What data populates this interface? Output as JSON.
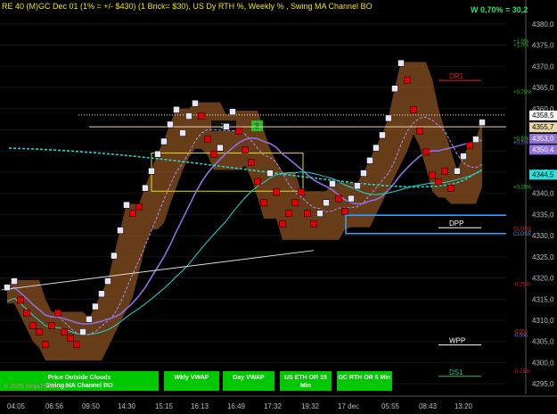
{
  "chart_title": "RE 40 (M)GC Dec 01  (1% = +/- $430) (1 Brick= $30), US Dy RTH %, Weekly % , Swing MA Channel BO",
  "weekly_stat": "W 0,70% = 30,2",
  "copyright": "© 2025 NinjaTrader, LLC",
  "colors": {
    "background": "#000000",
    "up_brick": "#e6e6f5",
    "down_brick": "#e00000",
    "band": "#8a5020",
    "ema_cyan": "#20d8d0",
    "ema_purple": "#9070e0",
    "buttons": "#00c800",
    "channel": "#e0e000"
  },
  "price_axis": {
    "ticks": [
      "4380,0",
      "4375,0",
      "4370,0",
      "4365,0",
      "4360,0",
      "4355,0",
      "4350,0",
      "4345,0",
      "4340,0",
      "4335,0",
      "4330,0",
      "4325,0",
      "4320,0",
      "4315,0",
      "4310,0",
      "4305,0",
      "4300,0",
      "4295,0"
    ],
    "ymin": 4292.5,
    "ymax": 4382.5
  },
  "price_badges": [
    {
      "value": "4358,5",
      "color": "#ffffff",
      "text_color": "#000000",
      "price": 4358.5
    },
    {
      "value": "4355,7",
      "color": "#e8d8a8",
      "text_color": "#000000",
      "price": 4355.7
    },
    {
      "value": "4353,0",
      "color": "#9070e0",
      "text_color": "#ffffff",
      "price": 4353.0
    },
    {
      "value": "4350,4",
      "color": "#9070e0",
      "text_color": "#ffffff",
      "price": 4350.4
    },
    {
      "value": "4344,5",
      "color": "#20e8e0",
      "text_color": "#000000",
      "price": 4344.5
    }
  ],
  "pct_labels": [
    {
      "text": "+1,0%",
      "color": "#20c020",
      "price": 4376.0
    },
    {
      "text": "+1,0%",
      "color": "#20c020",
      "price": 4375.0
    },
    {
      "text": "+0,75%",
      "color": "#20c020",
      "price": 4364.0
    },
    {
      "text": "+0,5%",
      "color": "#20c020",
      "price": 4353.0
    },
    {
      "text": "+0,5%",
      "color": "#9070e0",
      "price": 4352.0
    },
    {
      "text": "+0,25%",
      "color": "#20c020",
      "price": 4341.5
    },
    {
      "text": "CLOSE",
      "color": "#e02020",
      "price": 4331.6
    },
    {
      "text": "CLOSE",
      "color": "#5088e0",
      "price": 4330.4
    },
    {
      "text": "-0,25%",
      "color": "#e02020",
      "price": 4318.5
    },
    {
      "text": "-0,5%",
      "color": "#e02020",
      "price": 4307.4
    },
    {
      "text": "-0,5%",
      "color": "#9070e0",
      "price": 4306.5
    },
    {
      "text": "-0,75%",
      "color": "#e02020",
      "price": 4298.0
    }
  ],
  "levels": [
    {
      "label": "DR1",
      "color": "#e02020",
      "price": 4367.3
    },
    {
      "label": "DPP",
      "color": "#ffffff",
      "price": 4332.5
    },
    {
      "label": "WPP",
      "color": "#ffffff",
      "price": 4304.8
    },
    {
      "label": "DS1",
      "color": "#20c080",
      "price": 4297.4
    }
  ],
  "brick_labels": {
    "count_green": "3",
    "count_dark": "28"
  },
  "time_axis": [
    "04:05",
    "06:56",
    "09:50",
    "14:30",
    "15:15",
    "16:13",
    "16:49",
    "17:32",
    "19:32",
    "17 dec",
    "05:55",
    "08:43",
    "13:20"
  ],
  "buttons": [
    {
      "label": "Price Outside Clouds"
    },
    {
      "label": "Swing MA Channel BO"
    },
    {
      "label": "Wkly VWAP"
    },
    {
      "label": "Day VWAP"
    },
    {
      "label": "US ETH OR 15 Min"
    },
    {
      "label": "GC RTH OR 5 Min"
    }
  ],
  "chart_data": {
    "type": "renko",
    "brick_size": 1.5,
    "series": [
      {
        "name": "bricks",
        "bricks": [
          [
            8,
            4317.0,
            1
          ],
          [
            16,
            4318.5,
            1
          ],
          [
            23,
            4314.0,
            0
          ],
          [
            30,
            4311.0,
            0
          ],
          [
            37,
            4308.0,
            0
          ],
          [
            44,
            4306.5,
            0
          ],
          [
            51,
            4303.5,
            0
          ],
          [
            58,
            4308.0,
            0
          ],
          [
            65,
            4311.0,
            0
          ],
          [
            72,
            4306.5,
            0
          ],
          [
            79,
            4305.0,
            0
          ],
          [
            86,
            4303.5,
            0
          ],
          [
            93,
            4306.5,
            1
          ],
          [
            100,
            4309.5,
            1
          ],
          [
            107,
            4312.5,
            1
          ],
          [
            114,
            4315.5,
            1
          ],
          [
            121,
            4318.5,
            1
          ],
          [
            128,
            4324.5,
            1
          ],
          [
            135,
            4330.5,
            1
          ],
          [
            142,
            4336.5,
            1
          ],
          [
            149,
            4334.5,
            0
          ],
          [
            156,
            4336.0,
            0
          ],
          [
            163,
            4340.5,
            1
          ],
          [
            170,
            4344.5,
            1
          ],
          [
            177,
            4348.5,
            1
          ],
          [
            184,
            4351.5,
            1
          ],
          [
            191,
            4355.5,
            1
          ],
          [
            198,
            4359.0,
            1
          ],
          [
            205,
            4353.5,
            1
          ],
          [
            212,
            4357.5,
            1
          ],
          [
            219,
            4360.5,
            1
          ],
          [
            226,
            4357.5,
            0
          ],
          [
            233,
            4352.0,
            0
          ],
          [
            240,
            4348.5,
            0
          ],
          [
            247,
            4350.0,
            1
          ],
          [
            254,
            4355.0,
            1
          ],
          [
            261,
            4358.5,
            1
          ],
          [
            268,
            4354.0,
            0
          ],
          [
            275,
            4349.5,
            0
          ],
          [
            282,
            4346.5,
            0
          ],
          [
            289,
            4342.0,
            0
          ],
          [
            296,
            4337.0,
            0
          ],
          [
            303,
            4344.0,
            1
          ],
          [
            310,
            4339.5,
            0
          ],
          [
            317,
            4332.0,
            0
          ],
          [
            324,
            4334.5,
            0
          ],
          [
            331,
            4337.0,
            0
          ],
          [
            338,
            4339.5,
            0
          ],
          [
            345,
            4334.5,
            0
          ],
          [
            352,
            4332.0,
            0
          ],
          [
            359,
            4334.5,
            1
          ],
          [
            366,
            4337.0,
            1
          ],
          [
            373,
            4341.5,
            1
          ],
          [
            380,
            4338.0,
            0
          ],
          [
            387,
            4335.0,
            0
          ],
          [
            394,
            4338.0,
            1
          ],
          [
            401,
            4341.0,
            1
          ],
          [
            408,
            4344.0,
            1
          ],
          [
            415,
            4347.0,
            1
          ],
          [
            422,
            4350.0,
            1
          ],
          [
            429,
            4353.0,
            1
          ],
          [
            436,
            4357.0,
            1
          ],
          [
            443,
            4364.0,
            1
          ],
          [
            450,
            4370.0,
            1
          ],
          [
            457,
            4366.0,
            0
          ],
          [
            464,
            4359.0,
            0
          ],
          [
            471,
            4354.0,
            0
          ],
          [
            478,
            4349.0,
            0
          ],
          [
            485,
            4343.5,
            0
          ],
          [
            492,
            4342.0,
            0
          ],
          [
            499,
            4344.5,
            0
          ],
          [
            506,
            4340.5,
            0
          ],
          [
            513,
            4344.5,
            1
          ],
          [
            520,
            4348.0,
            1
          ],
          [
            527,
            4350.5,
            0
          ],
          [
            534,
            4352.0,
            1
          ],
          [
            541,
            4356.0,
            1
          ]
        ]
      }
    ]
  }
}
